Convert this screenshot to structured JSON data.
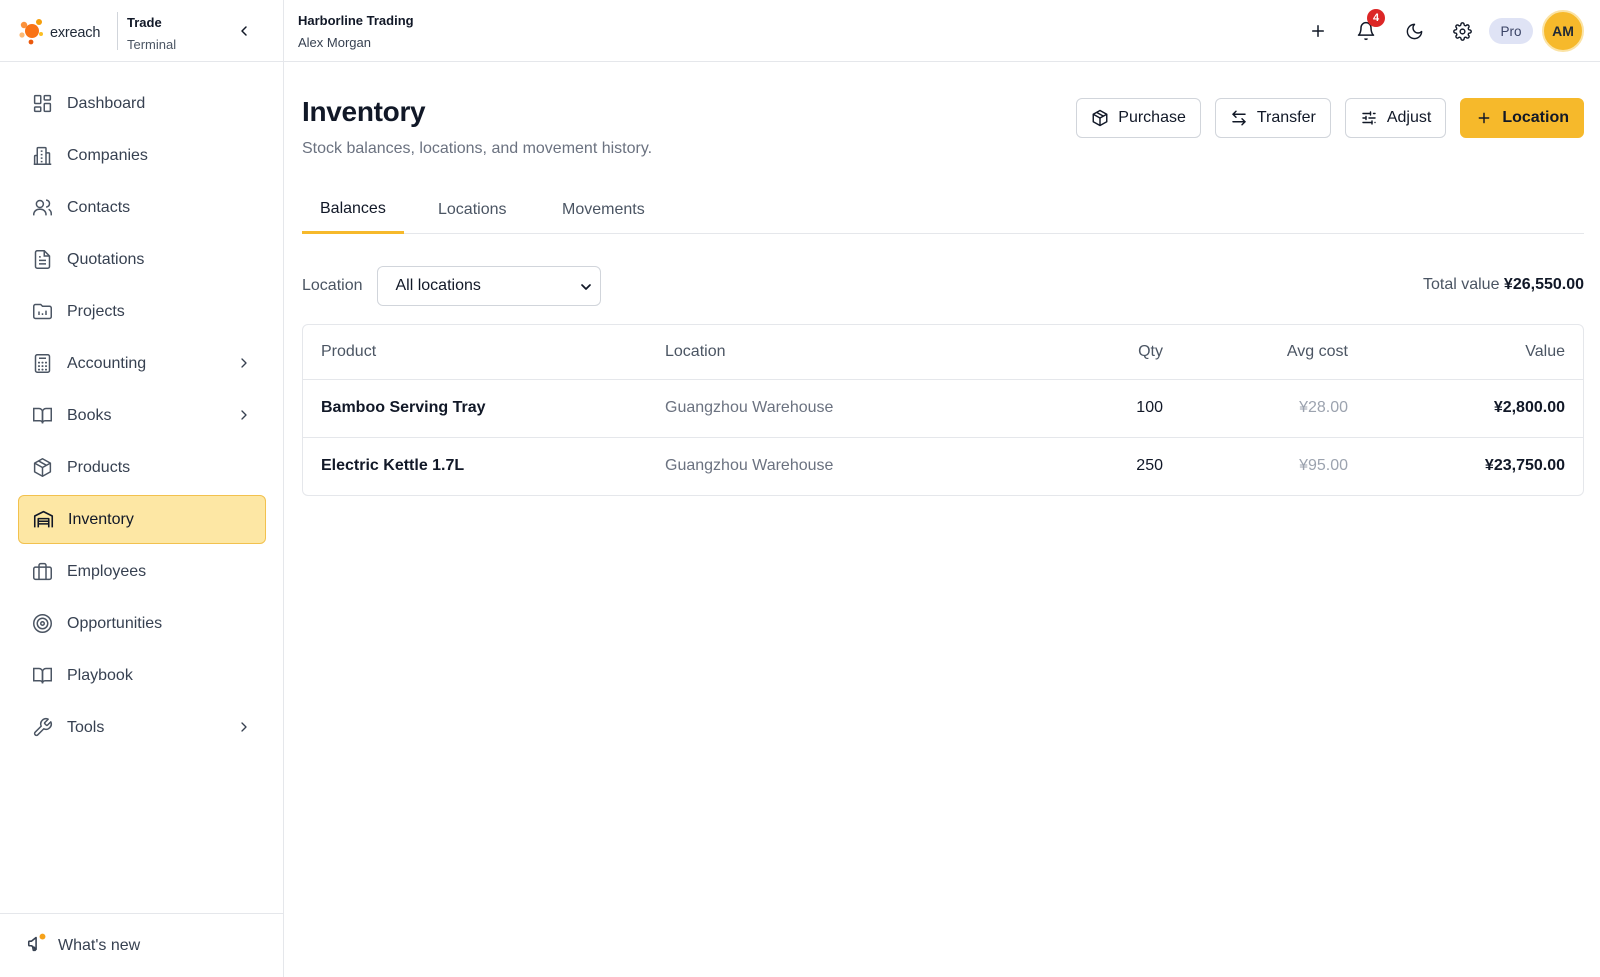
{
  "brand": {
    "logo_text": "exreach",
    "app_line1": "Trade",
    "app_line2": "Terminal"
  },
  "org": {
    "name": "Harborline Trading",
    "user": "Alex Morgan"
  },
  "topbar": {
    "notification_count": "4",
    "plan": "Pro",
    "avatar_initials": "AM"
  },
  "sidebar": {
    "items": [
      {
        "label": "Dashboard",
        "icon": "dashboard-icon"
      },
      {
        "label": "Companies",
        "icon": "building-icon"
      },
      {
        "label": "Contacts",
        "icon": "users-icon"
      },
      {
        "label": "Quotations",
        "icon": "document-icon"
      },
      {
        "label": "Projects",
        "icon": "folder-chart-icon"
      },
      {
        "label": "Accounting",
        "icon": "calculator-icon",
        "expandable": true
      },
      {
        "label": "Books",
        "icon": "book-icon",
        "expandable": true
      },
      {
        "label": "Products",
        "icon": "package-icon"
      },
      {
        "label": "Inventory",
        "icon": "warehouse-icon",
        "active": true
      },
      {
        "label": "Employees",
        "icon": "briefcase-icon"
      },
      {
        "label": "Opportunities",
        "icon": "target-icon"
      },
      {
        "label": "Playbook",
        "icon": "book-open-icon"
      },
      {
        "label": "Tools",
        "icon": "wrench-icon",
        "expandable": true
      }
    ],
    "footer_label": "What's new"
  },
  "page": {
    "title": "Inventory",
    "subtitle": "Stock balances, locations, and movement history.",
    "actions": {
      "purchase": "Purchase",
      "transfer": "Transfer",
      "adjust": "Adjust",
      "add_location": "Location"
    },
    "tabs": [
      "Balances",
      "Locations",
      "Movements"
    ],
    "active_tab": "Balances"
  },
  "filter": {
    "label": "Location",
    "selected": "All locations"
  },
  "summary": {
    "total_label": "Total value",
    "total_value": "¥26,550.00"
  },
  "table": {
    "headers": {
      "product": "Product",
      "location": "Location",
      "qty": "Qty",
      "avg_cost": "Avg cost",
      "value": "Value"
    },
    "rows": [
      {
        "product": "Bamboo Serving Tray",
        "location": "Guangzhou Warehouse",
        "qty": "100",
        "avg_cost": "¥28.00",
        "value": "¥2,800.00"
      },
      {
        "product": "Electric Kettle 1.7L",
        "location": "Guangzhou Warehouse",
        "qty": "250",
        "avg_cost": "¥95.00",
        "value": "¥23,750.00"
      }
    ]
  },
  "colors": {
    "accent": "#f6b92b",
    "active_nav_bg": "#fde7a4",
    "badge": "#dc2626"
  }
}
